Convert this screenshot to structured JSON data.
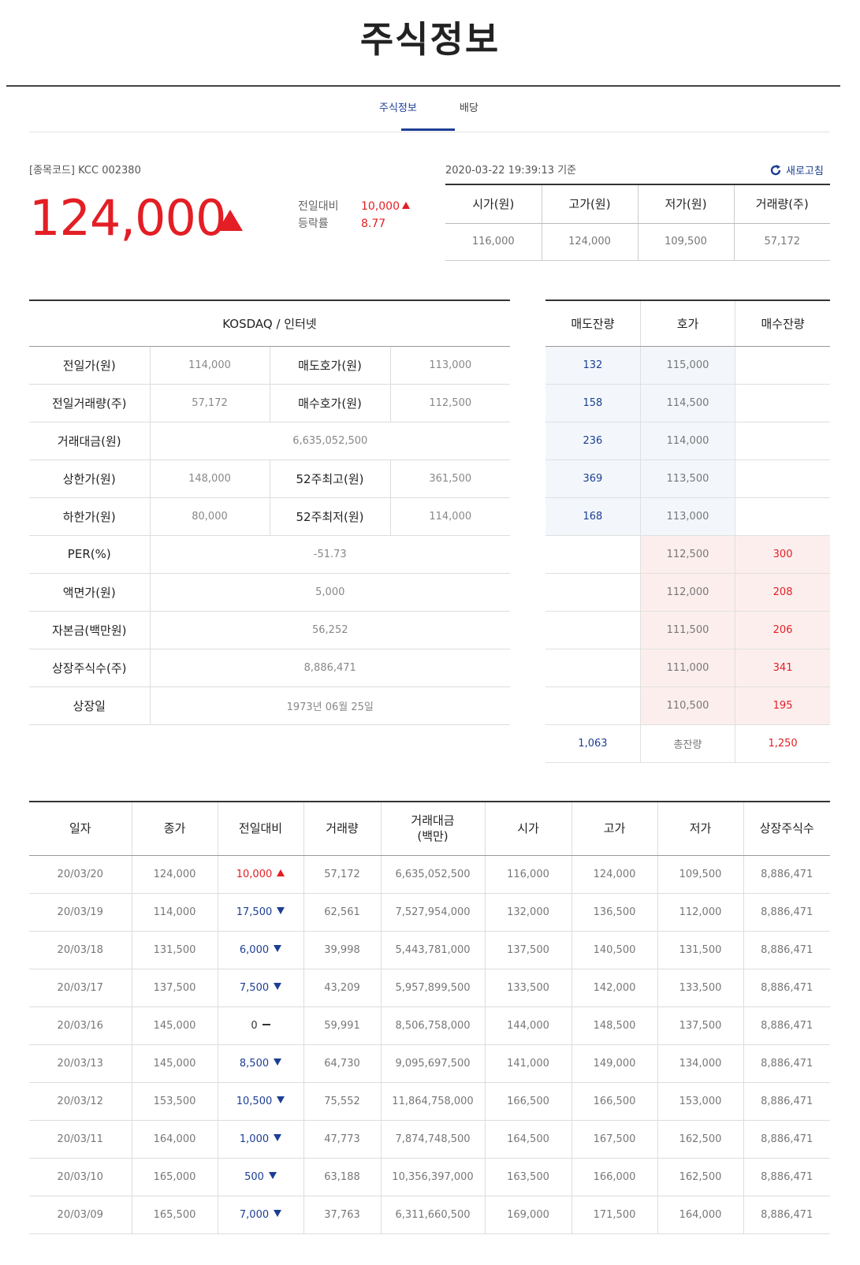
{
  "page": {
    "title": "주식정보"
  },
  "tabs": [
    {
      "label": "주식정보"
    },
    {
      "label": "배당"
    }
  ],
  "stock": {
    "code_label": "[종목코드] KCC 002380",
    "price": "124,000",
    "diff_label": "전일대비",
    "diff_value": "10,000",
    "rate_label": "등락률",
    "rate_value": "8.77",
    "timestamp": "2020-03-22 19:39:13 기준",
    "refresh_label": "새로고침"
  },
  "summary": {
    "headers": [
      "시가(원)",
      "고가(원)",
      "저가(원)",
      "거래량(주)"
    ],
    "values": [
      "116,000",
      "124,000",
      "109,500",
      "57,172"
    ]
  },
  "info": {
    "sector": "KOSDAQ / 인터넷",
    "rows": [
      {
        "l1": "전일가(원)",
        "v1": "114,000",
        "l2": "매도호가(원)",
        "v2": "113,000"
      },
      {
        "l1": "전일거래량(주)",
        "v1": "57,172",
        "l2": "매수호가(원)",
        "v2": "112,500"
      },
      {
        "l1": "거래대금(원)",
        "v1": "6,635,052,500"
      },
      {
        "l1": "상한가(원)",
        "v1": "148,000",
        "l2": "52주최고(원)",
        "v2": "361,500"
      },
      {
        "l1": "하한가(원)",
        "v1": "80,000",
        "l2": "52주최저(원)",
        "v2": "114,000"
      },
      {
        "l1": "PER(%)",
        "v1": "-51.73"
      },
      {
        "l1": "액면가(원)",
        "v1": "5,000"
      },
      {
        "l1": "자본금(백만원)",
        "v1": "56,252"
      },
      {
        "l1": "상장주식수(주)",
        "v1": "8,886,471"
      },
      {
        "l1": "상장일",
        "v1": "1973년 06월 25일"
      }
    ]
  },
  "hoga": {
    "headers": [
      "매도잔량",
      "호가",
      "매수잔량"
    ],
    "sell": [
      {
        "qty": "132",
        "price": "115,000"
      },
      {
        "qty": "158",
        "price": "114,500"
      },
      {
        "qty": "236",
        "price": "114,000"
      },
      {
        "qty": "369",
        "price": "113,500"
      },
      {
        "qty": "168",
        "price": "113,000"
      }
    ],
    "buy": [
      {
        "price": "112,500",
        "qty": "300"
      },
      {
        "price": "112,000",
        "qty": "208"
      },
      {
        "price": "111,500",
        "qty": "206"
      },
      {
        "price": "111,000",
        "qty": "341"
      },
      {
        "price": "110,500",
        "qty": "195"
      }
    ],
    "total_sell": "1,063",
    "total_label": "총잔량",
    "total_buy": "1,250"
  },
  "history": {
    "headers": [
      "일자",
      "종가",
      "전일대비",
      "거래량",
      "거래대금",
      "(백만)",
      "시가",
      "고가",
      "저가",
      "상장주식수"
    ],
    "rows": [
      {
        "date": "20/03/20",
        "close": "124,000",
        "diff": "10,000",
        "dir": "up",
        "volume": "57,172",
        "amount": "6,635,052,500",
        "open": "116,000",
        "high": "124,000",
        "low": "109,500",
        "shares": "8,886,471"
      },
      {
        "date": "20/03/19",
        "close": "114,000",
        "diff": "17,500",
        "dir": "down",
        "volume": "62,561",
        "amount": "7,527,954,000",
        "open": "132,000",
        "high": "136,500",
        "low": "112,000",
        "shares": "8,886,471"
      },
      {
        "date": "20/03/18",
        "close": "131,500",
        "diff": "6,000",
        "dir": "down",
        "volume": "39,998",
        "amount": "5,443,781,000",
        "open": "137,500",
        "high": "140,500",
        "low": "131,500",
        "shares": "8,886,471"
      },
      {
        "date": "20/03/17",
        "close": "137,500",
        "diff": "7,500",
        "dir": "down",
        "volume": "43,209",
        "amount": "5,957,899,500",
        "open": "133,500",
        "high": "142,000",
        "low": "133,500",
        "shares": "8,886,471"
      },
      {
        "date": "20/03/16",
        "close": "145,000",
        "diff": "0",
        "dir": "flat",
        "volume": "59,991",
        "amount": "8,506,758,000",
        "open": "144,000",
        "high": "148,500",
        "low": "137,500",
        "shares": "8,886,471"
      },
      {
        "date": "20/03/13",
        "close": "145,000",
        "diff": "8,500",
        "dir": "down",
        "volume": "64,730",
        "amount": "9,095,697,500",
        "open": "141,000",
        "high": "149,000",
        "low": "134,000",
        "shares": "8,886,471"
      },
      {
        "date": "20/03/12",
        "close": "153,500",
        "diff": "10,500",
        "dir": "down",
        "volume": "75,552",
        "amount": "11,864,758,000",
        "open": "166,500",
        "high": "166,500",
        "low": "153,000",
        "shares": "8,886,471"
      },
      {
        "date": "20/03/11",
        "close": "164,000",
        "diff": "1,000",
        "dir": "down",
        "volume": "47,773",
        "amount": "7,874,748,500",
        "open": "164,500",
        "high": "167,500",
        "low": "162,500",
        "shares": "8,886,471"
      },
      {
        "date": "20/03/10",
        "close": "165,000",
        "diff": "500",
        "dir": "down",
        "volume": "63,188",
        "amount": "10,356,397,000",
        "open": "163,500",
        "high": "166,000",
        "low": "162,500",
        "shares": "8,886,471"
      },
      {
        "date": "20/03/09",
        "close": "165,500",
        "diff": "7,000",
        "dir": "down",
        "volume": "37,763",
        "amount": "6,311,660,500",
        "open": "169,000",
        "high": "171,500",
        "low": "164,000",
        "shares": "8,886,471"
      }
    ]
  },
  "colors": {
    "up": "#e31e24",
    "down": "#1c3f94",
    "accent": "#1c3f94"
  }
}
